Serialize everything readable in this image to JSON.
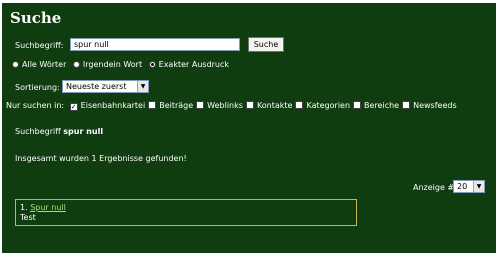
{
  "page_title": "Suche",
  "search": {
    "label": "Suchbegriff:",
    "value": "spur null",
    "button": "Suche"
  },
  "match_options": {
    "all_words": "Alle Wörter",
    "any_word": "Irgendein Wort",
    "exact": "Exakter Ausdruck",
    "selected": "exact"
  },
  "sort": {
    "label": "Sortierung:",
    "value": "Neueste zuerst"
  },
  "areas": {
    "label": "Nur suchen in:",
    "items": [
      {
        "label": "Eisenbahnkartei",
        "checked": true
      },
      {
        "label": "Beiträge",
        "checked": false
      },
      {
        "label": "Weblinks",
        "checked": false
      },
      {
        "label": "Kontakte",
        "checked": false
      },
      {
        "label": "Kategorien",
        "checked": false
      },
      {
        "label": "Bereiche",
        "checked": false
      },
      {
        "label": "Newsfeeds",
        "checked": false
      }
    ]
  },
  "summary": {
    "prefix": "Suchbegriff",
    "term": "spur null",
    "total": "Insgesamt wurden 1 Ergebnisse gefunden!"
  },
  "display": {
    "label": "Anzeige #",
    "value": "20"
  },
  "results": [
    {
      "number": "1.",
      "title": "Spur null",
      "text": "Test"
    }
  ]
}
